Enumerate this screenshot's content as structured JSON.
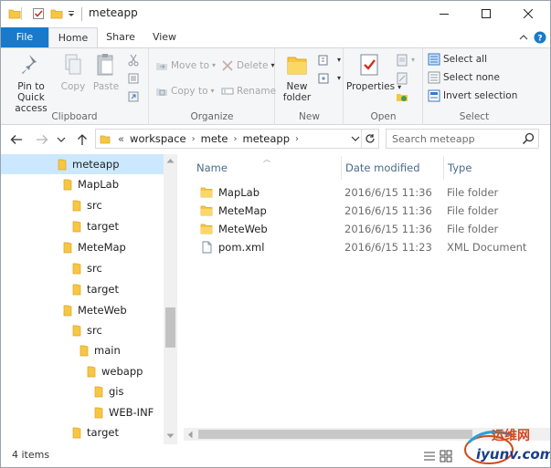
{
  "window": {
    "title": "meteapp"
  },
  "ribbon_tabs": [
    {
      "label": "File"
    },
    {
      "label": "Home"
    },
    {
      "label": "Share"
    },
    {
      "label": "View"
    }
  ],
  "ribbon": {
    "clipboard": {
      "label": "Clipboard",
      "pin": "Pin to Quick access",
      "pin_line1": "Pin to Quick",
      "pin_line2": "access",
      "copy": "Copy",
      "paste": "Paste"
    },
    "organize": {
      "label": "Organize",
      "move_to": "Move to",
      "copy_to": "Copy to",
      "delete": "Delete",
      "rename": "Rename"
    },
    "new": {
      "label": "New",
      "new_folder_line1": "New",
      "new_folder_line2": "folder"
    },
    "open": {
      "label": "Open",
      "properties": "Properties"
    },
    "select": {
      "label": "Select",
      "select_all": "Select all",
      "select_none": "Select none",
      "invert": "Invert selection"
    }
  },
  "address": {
    "overflow": "«",
    "crumbs": [
      "workspace",
      "mete",
      "meteapp"
    ]
  },
  "search": {
    "placeholder": "Search meteapp"
  },
  "nav_tree": [
    {
      "label": "meteapp",
      "level": 0,
      "selected": true
    },
    {
      "label": "MapLab",
      "level": 1
    },
    {
      "label": "src",
      "level": 2
    },
    {
      "label": "target",
      "level": 2
    },
    {
      "label": "MeteMap",
      "level": 1
    },
    {
      "label": "src",
      "level": 2
    },
    {
      "label": "target",
      "level": 2
    },
    {
      "label": "MeteWeb",
      "level": 1
    },
    {
      "label": "src",
      "level": 2
    },
    {
      "label": "main",
      "level": 3
    },
    {
      "label": "webapp",
      "level": 4
    },
    {
      "label": "gis",
      "level": 5
    },
    {
      "label": "WEB-INF",
      "level": 5
    },
    {
      "label": "target",
      "level": 2
    }
  ],
  "columns": {
    "name": "Name",
    "date": "Date modified",
    "type": "Type"
  },
  "files": [
    {
      "name": "MapLab",
      "date": "2016/6/15 11:36",
      "type": "File folder",
      "kind": "folder"
    },
    {
      "name": "MeteMap",
      "date": "2016/6/15 11:36",
      "type": "File folder",
      "kind": "folder"
    },
    {
      "name": "MeteWeb",
      "date": "2016/6/15 11:36",
      "type": "File folder",
      "kind": "folder"
    },
    {
      "name": "pom.xml",
      "date": "2016/6/15 11:23",
      "type": "XML Document",
      "kind": "file"
    }
  ],
  "status": {
    "items": "4 items"
  },
  "watermark": {
    "line1": "运维网",
    "line2": "iyunv.com"
  },
  "colors": {
    "file_tab": "#1979ca",
    "folder": "#f7c744",
    "selection": "#cce8ff"
  }
}
